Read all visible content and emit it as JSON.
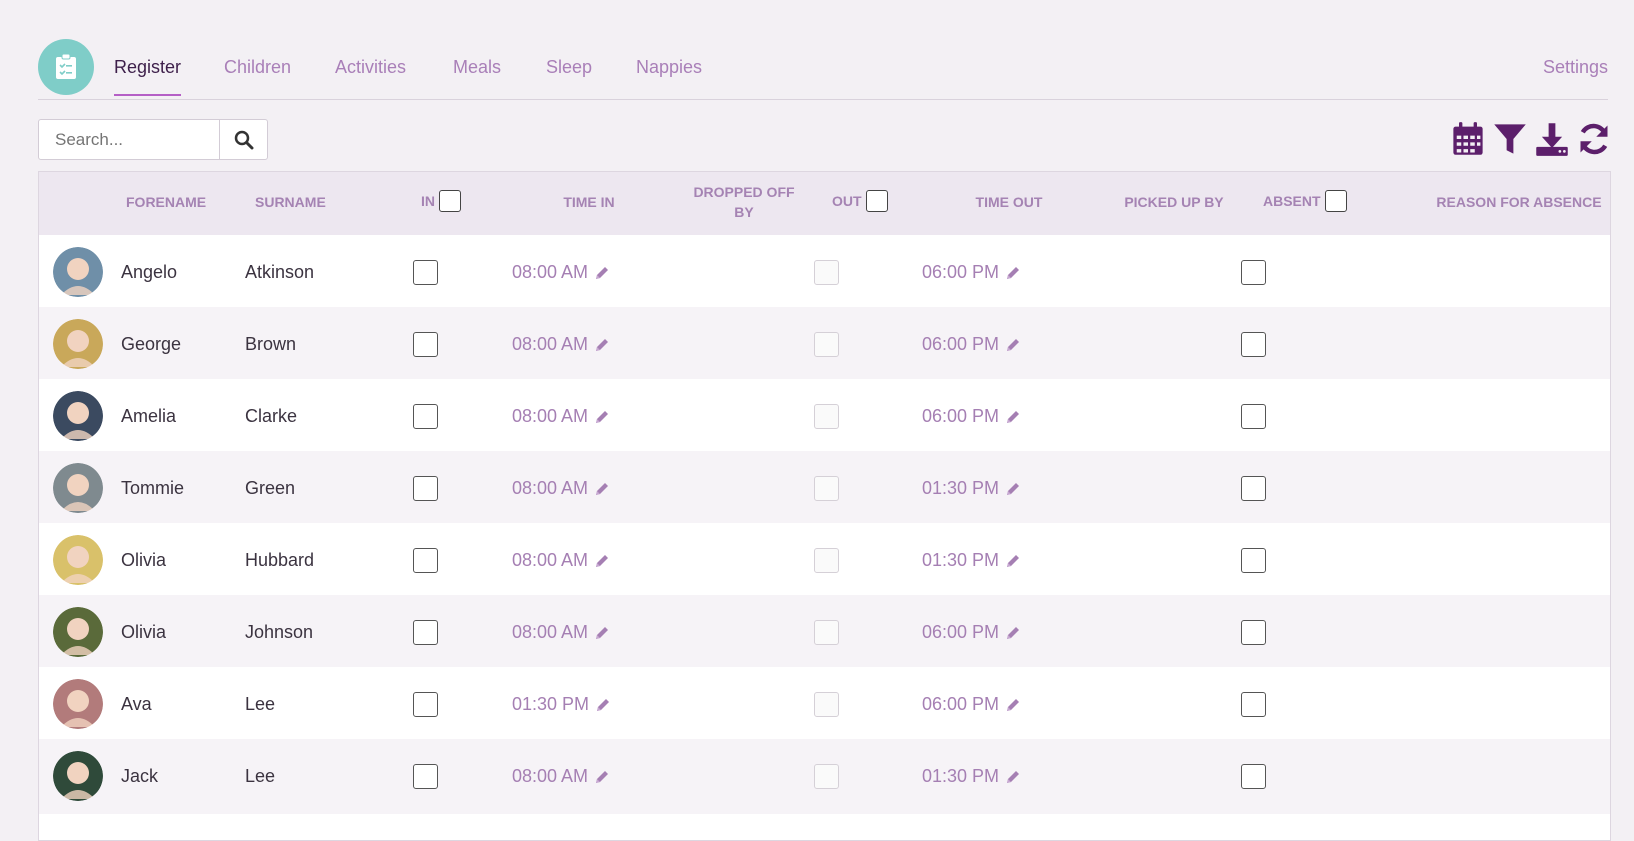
{
  "nav": {
    "tabs": [
      {
        "label": "Register",
        "active": true
      },
      {
        "label": "Children",
        "active": false
      },
      {
        "label": "Activities",
        "active": false
      },
      {
        "label": "Meals",
        "active": false
      },
      {
        "label": "Sleep",
        "active": false
      },
      {
        "label": "Nappies",
        "active": false
      }
    ],
    "settings_label": "Settings",
    "logo_icon": "clipboard-checklist-icon"
  },
  "search": {
    "placeholder": "Search...",
    "value": "",
    "icon": "search-icon"
  },
  "toolbar": {
    "icons": [
      "calendar-icon",
      "filter-icon",
      "download-icon",
      "refresh-icon"
    ],
    "color": "#5c1f6b"
  },
  "table": {
    "headers": {
      "forename": "FORENAME",
      "surname": "SURNAME",
      "in": "IN",
      "time_in": "TIME IN",
      "dropped_off_by": "DROPPED OFF BY",
      "out": "OUT",
      "time_out": "TIME OUT",
      "picked_up_by": "PICKED UP BY",
      "absent": "ABSENT",
      "reason": "REASON FOR ABSENCE"
    },
    "rows": [
      {
        "forename": "Angelo",
        "surname": "Atkinson",
        "time_in": "08:00 AM",
        "time_out": "06:00 PM",
        "avatar_color": "#6f8fa8"
      },
      {
        "forename": "George",
        "surname": "Brown",
        "time_in": "08:00 AM",
        "time_out": "06:00 PM",
        "avatar_color": "#c9a85a"
      },
      {
        "forename": "Amelia",
        "surname": "Clarke",
        "time_in": "08:00 AM",
        "time_out": "06:00 PM",
        "avatar_color": "#3b4a60"
      },
      {
        "forename": "Tommie",
        "surname": "Green",
        "time_in": "08:00 AM",
        "time_out": "01:30 PM",
        "avatar_color": "#7f8a8f"
      },
      {
        "forename": "Olivia",
        "surname": "Hubbard",
        "time_in": "08:00 AM",
        "time_out": "01:30 PM",
        "avatar_color": "#d9c16a"
      },
      {
        "forename": "Olivia",
        "surname": "Johnson",
        "time_in": "08:00 AM",
        "time_out": "06:00 PM",
        "avatar_color": "#5a6a3a"
      },
      {
        "forename": "Ava",
        "surname": "Lee",
        "time_in": "01:30 PM",
        "time_out": "06:00 PM",
        "avatar_color": "#b27b7b"
      },
      {
        "forename": "Jack",
        "surname": "Lee",
        "time_in": "08:00 AM",
        "time_out": "01:30 PM",
        "avatar_color": "#2f4a3a"
      }
    ]
  }
}
